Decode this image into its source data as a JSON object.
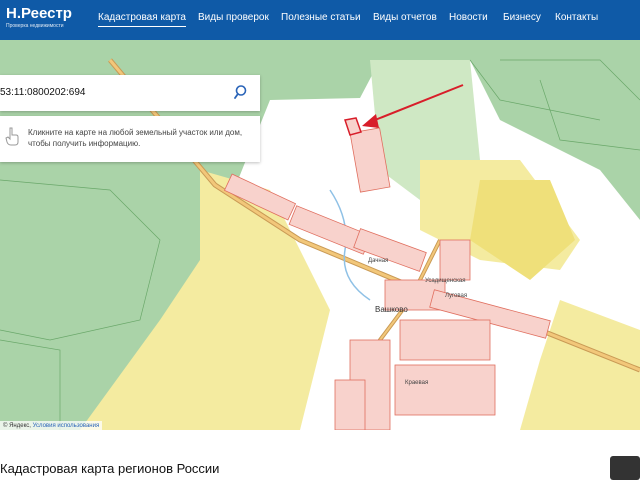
{
  "header": {
    "logo_title": "Н.Реестр",
    "logo_subtitle": "Проверка недвижимости",
    "nav": [
      {
        "label": "Кадастровая карта",
        "active": true
      },
      {
        "label": "Виды проверок"
      },
      {
        "label": "Полезные статьи"
      },
      {
        "label": "Виды отчетов"
      },
      {
        "label": "Новости"
      },
      {
        "label": "Бизнесу"
      },
      {
        "label": "Контакты"
      }
    ]
  },
  "search": {
    "value": "53:11:0800202:694",
    "icon": "search-icon"
  },
  "hint": {
    "text": "Кликните на карте на любой земельный участок или дом, чтобы получить информацию.",
    "icon": "hand-pointer-icon"
  },
  "map": {
    "village_label": "Вашково",
    "street_labels": [
      "Усадищенская",
      "Дачная",
      "Луговая",
      "Краевая"
    ],
    "attribution_prefix": "© Яндекс,",
    "attribution_link": "Условия использования"
  },
  "colors": {
    "header_bg": "#0f5aa7",
    "forest": "#aad3a8",
    "field": "#f4eba0",
    "parcel_fill": "#f8d2cc",
    "parcel_stroke": "#e06f5f",
    "arrow": "#d81e2a"
  },
  "page": {
    "section_title": "Кадастровая карта регионов России"
  }
}
